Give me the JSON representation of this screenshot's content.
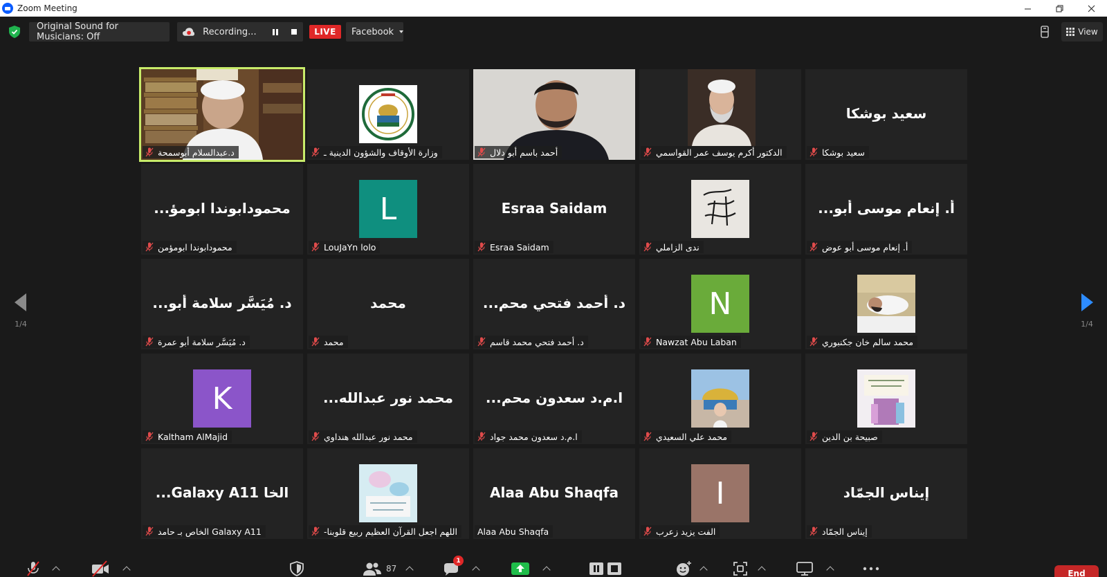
{
  "window": {
    "title": "Zoom Meeting"
  },
  "topbar": {
    "sound_label": "Original Sound for Musicians: Off",
    "recording_label": "Recording...",
    "live_label": "LIVE",
    "stream_target": "Facebook",
    "view_label": "View"
  },
  "grid": {
    "tiles": [
      {
        "name": "د.عبدالسلام أبوسمحة",
        "display": "",
        "kind": "video",
        "active": true
      },
      {
        "name": "وزارة الأوقاف والشؤون الدينية ـ",
        "display": "",
        "kind": "logo",
        "active": false
      },
      {
        "name": "أحمد باسم أبو دلال",
        "display": "",
        "kind": "video2",
        "active": false
      },
      {
        "name": "الدكتور أكرم يوسف عمر القواسمي",
        "display": "",
        "kind": "portrait",
        "active": false
      },
      {
        "name": "سعيد بوشكا",
        "display": "سعيد بوشكا",
        "kind": "text",
        "active": false
      },
      {
        "name": "محمودابوندا ابومؤمن",
        "display": "...محمودابوندا ابومؤ",
        "kind": "text",
        "active": false
      },
      {
        "name": "LouJaYn lolo",
        "display": "L",
        "kind": "letter",
        "color": "#0f8f7f",
        "active": false
      },
      {
        "name": "Esraa  Saidam",
        "display": "Esraa  Saidam",
        "kind": "text",
        "active": false
      },
      {
        "name": "ندى الزاملي",
        "display": "",
        "kind": "calligraphy",
        "active": false
      },
      {
        "name": "أ. إنعام موسى أبو عوض",
        "display": "...أ. إنعام موسى أبو",
        "kind": "text",
        "active": false
      },
      {
        "name": "د. مُيَسَّر سلامة أبو عمرة",
        "display": "...د. مُيَسَّر سلامة أبو",
        "kind": "text",
        "active": false
      },
      {
        "name": "محمد",
        "display": "محمد",
        "kind": "text",
        "active": false
      },
      {
        "name": "د. أحمد فتحي محمد قاسم",
        "display": "...د. أحمد فتحي محم",
        "kind": "text",
        "active": false
      },
      {
        "name": "Nawzat Abu Laban",
        "display": "N",
        "kind": "letter",
        "color": "#6aab3a",
        "active": false
      },
      {
        "name": "محمد سالم خان جكنبوري",
        "display": "",
        "kind": "lying",
        "active": false
      },
      {
        "name": "Kaltham AlMajid",
        "display": "K",
        "kind": "letter",
        "color": "#8b55c9",
        "active": false
      },
      {
        "name": "محمد نور عبدالله هنداوي",
        "display": "...محمد نور عبدالله",
        "kind": "text",
        "active": false
      },
      {
        "name": "ا.م.د سعدون محمد جواد",
        "display": "...ا.م.د سعدون محم",
        "kind": "text",
        "active": false
      },
      {
        "name": "محمد علي السعيدي",
        "display": "",
        "kind": "dome",
        "active": false
      },
      {
        "name": "صبيحة بن الدين",
        "display": "",
        "kind": "book",
        "active": false
      },
      {
        "name": "الخاص بـ حامد Galaxy A11",
        "display": "...Galaxy A11 الخا",
        "kind": "text",
        "active": false
      },
      {
        "name": "-اللهم اجعل القرآن العظيم ربيع قلوبنا",
        "display": "",
        "kind": "flowers",
        "active": false
      },
      {
        "name": "Alaa Abu Shaqfa",
        "display": "Alaa Abu Shaqfa",
        "kind": "text",
        "nomic": true,
        "active": false
      },
      {
        "name": "الفت يزيد زعرب",
        "display": "I",
        "kind": "letter",
        "color": "#9a7468",
        "active": false
      },
      {
        "name": "إيناس الجمّاد",
        "display": "إيناس الجمّاد",
        "kind": "text",
        "active": false
      }
    ]
  },
  "pager": {
    "left_label": "1/4",
    "right_label": "1/4"
  },
  "bottombar": {
    "participants_count": "87",
    "chat_badge": "1",
    "end_label": "End"
  },
  "colors": {
    "active_speaker": "#c8ec6a",
    "live": "#e02828",
    "end": "#c52727",
    "share_green": "#1fbd4a",
    "pager_blue": "#2d8cff"
  }
}
